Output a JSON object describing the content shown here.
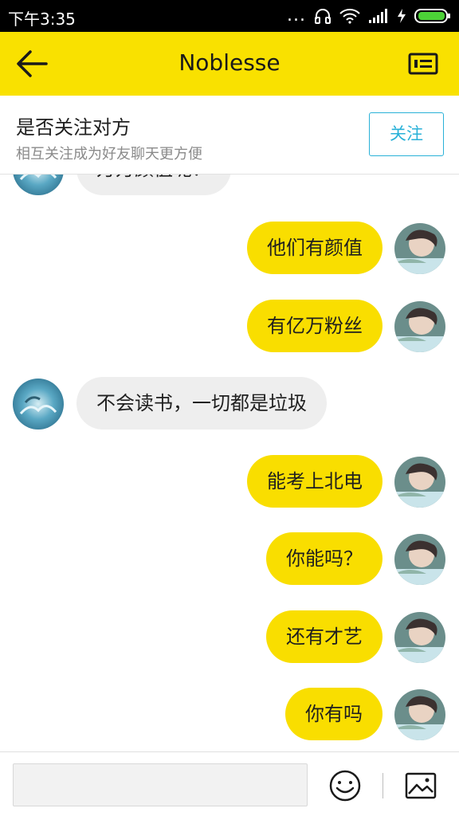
{
  "status_bar": {
    "time": "下午3:35",
    "dots": "...",
    "icons": [
      "headphone-icon",
      "wifi-icon",
      "signal-icon",
      "charging-icon",
      "battery-icon"
    ],
    "battery_color": "#4cd137"
  },
  "header": {
    "title": "Noblesse",
    "background": "#f9e100",
    "back_icon": "back-arrow-icon",
    "profile_icon": "profile-card-icon"
  },
  "follow_banner": {
    "title": "是否关注对方",
    "subtitle": "相互关注成为好友聊天更方便",
    "follow_label": "关注",
    "accent": "#29b1d8"
  },
  "messages": [
    {
      "side": "left",
      "text": "万万颜值呢？"
    },
    {
      "side": "right",
      "text": "他们有颜值"
    },
    {
      "side": "right",
      "text": "有亿万粉丝"
    },
    {
      "side": "left",
      "text": "不会读书，一切都是垃圾"
    },
    {
      "side": "right",
      "text": "能考上北电"
    },
    {
      "side": "right",
      "text": "你能吗？"
    },
    {
      "side": "right",
      "text": "还有才艺"
    },
    {
      "side": "right",
      "text": "你有吗"
    }
  ],
  "colors": {
    "my_bubble": "#f9de00",
    "their_bubble": "#eeeeee"
  },
  "input_bar": {
    "value": "",
    "placeholder": "",
    "emoji_icon": "emoji-icon",
    "image_icon": "image-icon"
  }
}
